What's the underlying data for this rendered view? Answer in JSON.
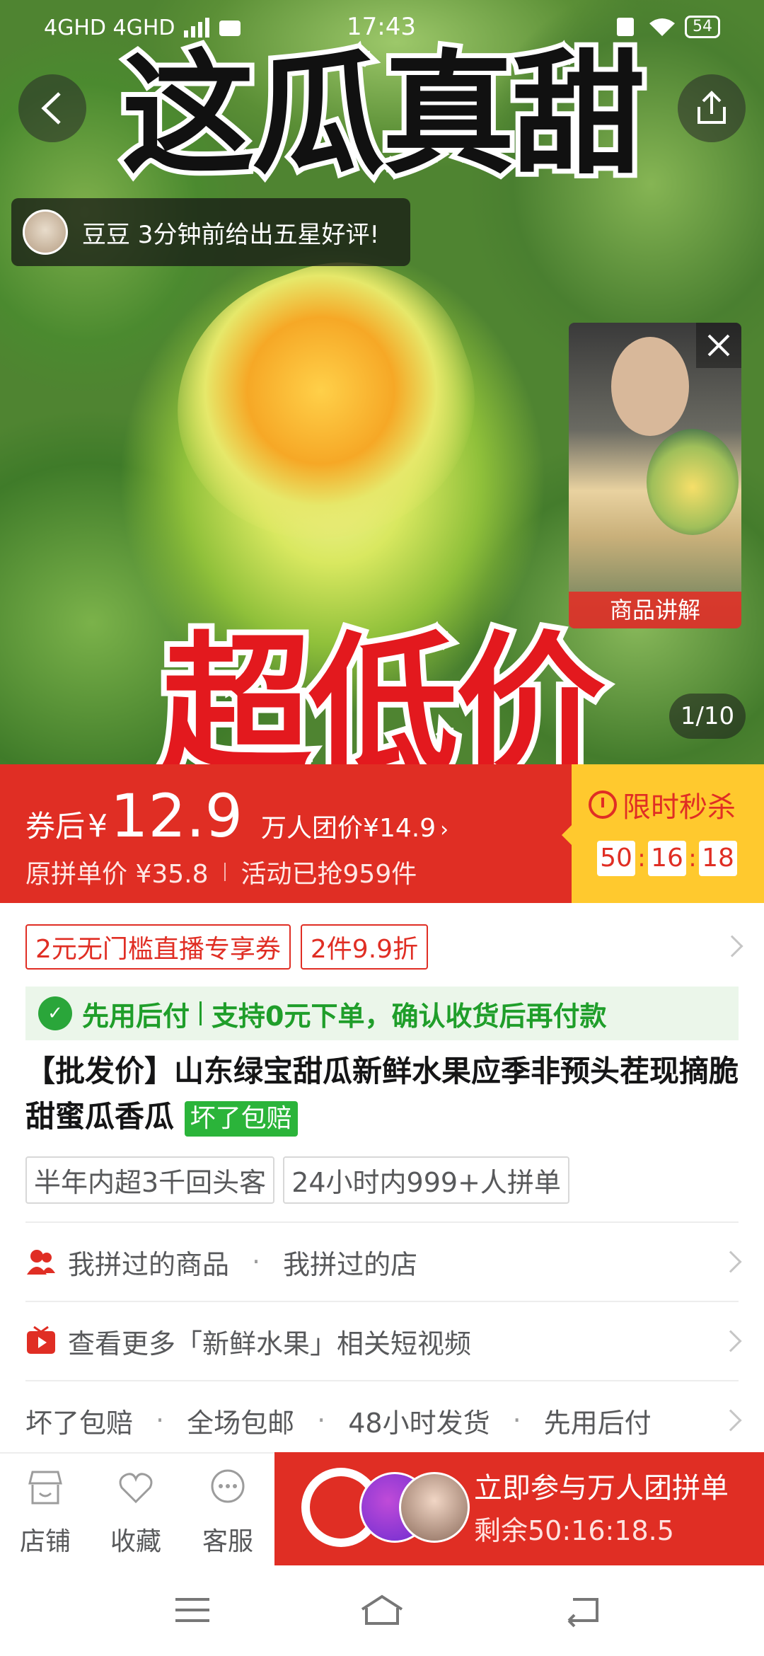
{
  "status_bar": {
    "left": "4GHD 4GHD",
    "time": "17:43",
    "battery": "54"
  },
  "hero": {
    "headline_top": "这瓜真甜",
    "headline_bottom": "超低价",
    "toast_text": "豆豆 3分钟前给出五星好评!",
    "video_label": "商品讲解",
    "counter": "1/10"
  },
  "price": {
    "prefix": "券后",
    "currency": "¥",
    "value": "12.9",
    "group_price": "万人团价¥14.9",
    "original": "原拼单价 ¥35.8",
    "sold": "活动已抢959件"
  },
  "flash_sale": {
    "title": "限时秒杀",
    "hours": "50",
    "minutes": "16",
    "seconds": "18"
  },
  "coupons": [
    "2元无门槛直播专享券",
    "2件9.9折"
  ],
  "pay_later": {
    "title": "先用后付",
    "detail": "支持0元下单，确认收货后再付款"
  },
  "product": {
    "title": "【批发价】山东绿宝甜瓜新鲜水果应季非预头茬现摘脆甜蜜瓜香瓜",
    "badge": "坏了包赔"
  },
  "tags": [
    "半年内超3千回头客",
    "24小时内999+人拼单"
  ],
  "rows": {
    "history_goods": "我拼过的商品",
    "history_shops": "我拼过的店",
    "videos": "查看更多「新鲜水果」相关短视频",
    "services": [
      "坏了包赔",
      "全场包邮",
      "48小时发货",
      "先用后付"
    ]
  },
  "bottom_bar": {
    "store": "店铺",
    "favorite": "收藏",
    "service": "客服",
    "cta_title": "立即参与万人团拼单",
    "cta_sub": "剩余50:16:18.5"
  },
  "colors": {
    "brand_red": "#e02e24",
    "flash_yellow": "#ffc92e",
    "green": "#2bb43a"
  }
}
